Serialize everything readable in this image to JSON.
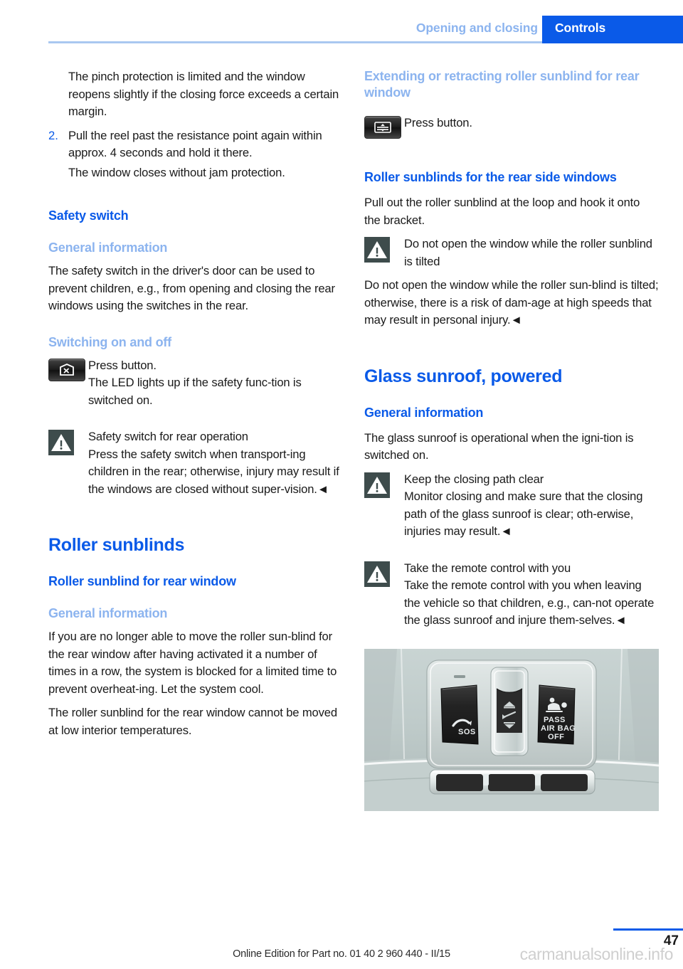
{
  "header": {
    "chapter": "Opening and closing",
    "section": "Controls"
  },
  "left_column": {
    "para_pinch": "The pinch protection is limited and the window reopens slightly if the closing force exceeds a certain margin.",
    "list_item_2_number": "2.",
    "list_item_2_text": "Pull the reel past the resistance point again within approx. 4 seconds and hold it there.",
    "para_window_closes": "The window closes without jam protection.",
    "heading_safety_switch": "Safety switch",
    "heading_general_information": "General information",
    "para_safety_switch": "The safety switch in the driver's door can be used to prevent children, e.g., from opening and closing the rear windows using the switches in the rear.",
    "heading_switching_on_off": "Switching on and off",
    "press_button": "Press button.",
    "led_text": "The LED lights up if the safety func-tion is switched on.",
    "warning_title": "Safety switch for rear operation",
    "warning_body": "Press the safety switch when transport-ing children in the rear; otherwise, injury may result if the windows are closed without super-vision.◄",
    "heading_roller_sunblinds": "Roller sunblinds",
    "heading_roller_sunblind_rear": "Roller sunblind for rear window",
    "heading_general_information_2": "General information",
    "para_overheat": "If you are no longer able to move the roller sun-blind for the rear window after having activated it a number of times in a row, the system is blocked for a limited time to prevent overheat-ing. Let the system cool.",
    "para_low_temp": "The roller sunblind for the rear window cannot be moved at low interior temperatures."
  },
  "right_column": {
    "heading_extending": "Extending or retracting roller sunblind for rear window",
    "press_button": "Press button.",
    "heading_rear_side_windows": "Roller sunblinds for the rear side windows",
    "para_pull_out": "Pull out the roller sunblind at the loop and hook it onto the bracket.",
    "warning_tilted_title": "Do not open the window while the roller sunblind is tilted",
    "warning_tilted_body": "Do not open the window while the roller sun-blind is tilted; otherwise, there is a risk of dam-age at high speeds that may result in personal injury.◄",
    "heading_glass_sunroof": "Glass sunroof, powered",
    "heading_general_information": "General information",
    "para_operational": "The glass sunroof is operational when the igni-tion is switched on.",
    "warning_closing_path_title": "Keep the closing path clear",
    "warning_closing_path_body": "Monitor closing and make sure that the closing path of the glass sunroof is clear; oth-erwise, injuries may result.◄",
    "warning_remote_title": "Take the remote control with you",
    "warning_remote_body": "Take the remote control with you when leaving the vehicle so that children, e.g., can-not operate the glass sunroof and injure them-selves.◄"
  },
  "photo": {
    "caption_sos": "SOS",
    "caption_pass": "PASS",
    "caption_airbag": "AIR BAG",
    "caption_off": "OFF"
  },
  "footer": {
    "page_number": "47",
    "edition": "Online Edition for Part no. 01 40 2 960 440 - II/15",
    "watermark": "carmanualsonline.info"
  },
  "colors": {
    "brand_blue": "#0a5ae8",
    "light_blue": "#8cb4ef",
    "warn_icon_bg": "#3e4c4c",
    "text": "#1a1a1a"
  }
}
